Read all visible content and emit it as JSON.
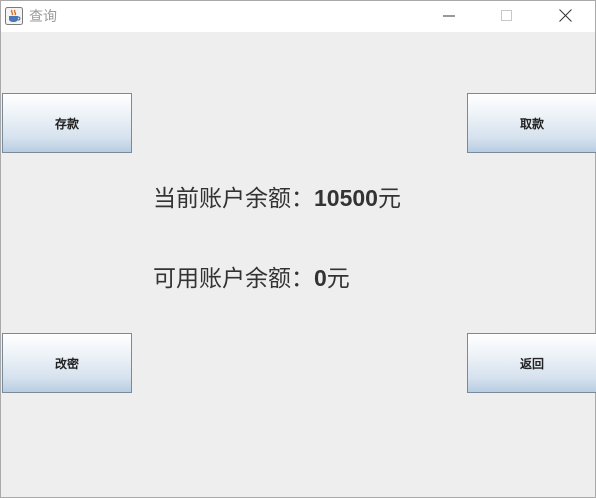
{
  "window": {
    "title": "查询",
    "icon": "java-cup-icon",
    "controls": [
      "minimize-icon",
      "maximize-icon",
      "close-icon"
    ]
  },
  "buttons": {
    "deposit": "存款",
    "withdraw": "取款",
    "change_password": "改密",
    "back": "返回"
  },
  "balance": {
    "current_label": "当前账户余额：",
    "current_value": "10500",
    "available_label": "可用账户余额：",
    "available_value": "0",
    "unit": "元"
  },
  "colors": {
    "window_bg": "#eeeeee",
    "text": "#333333",
    "button_border": "#7a8a99"
  }
}
